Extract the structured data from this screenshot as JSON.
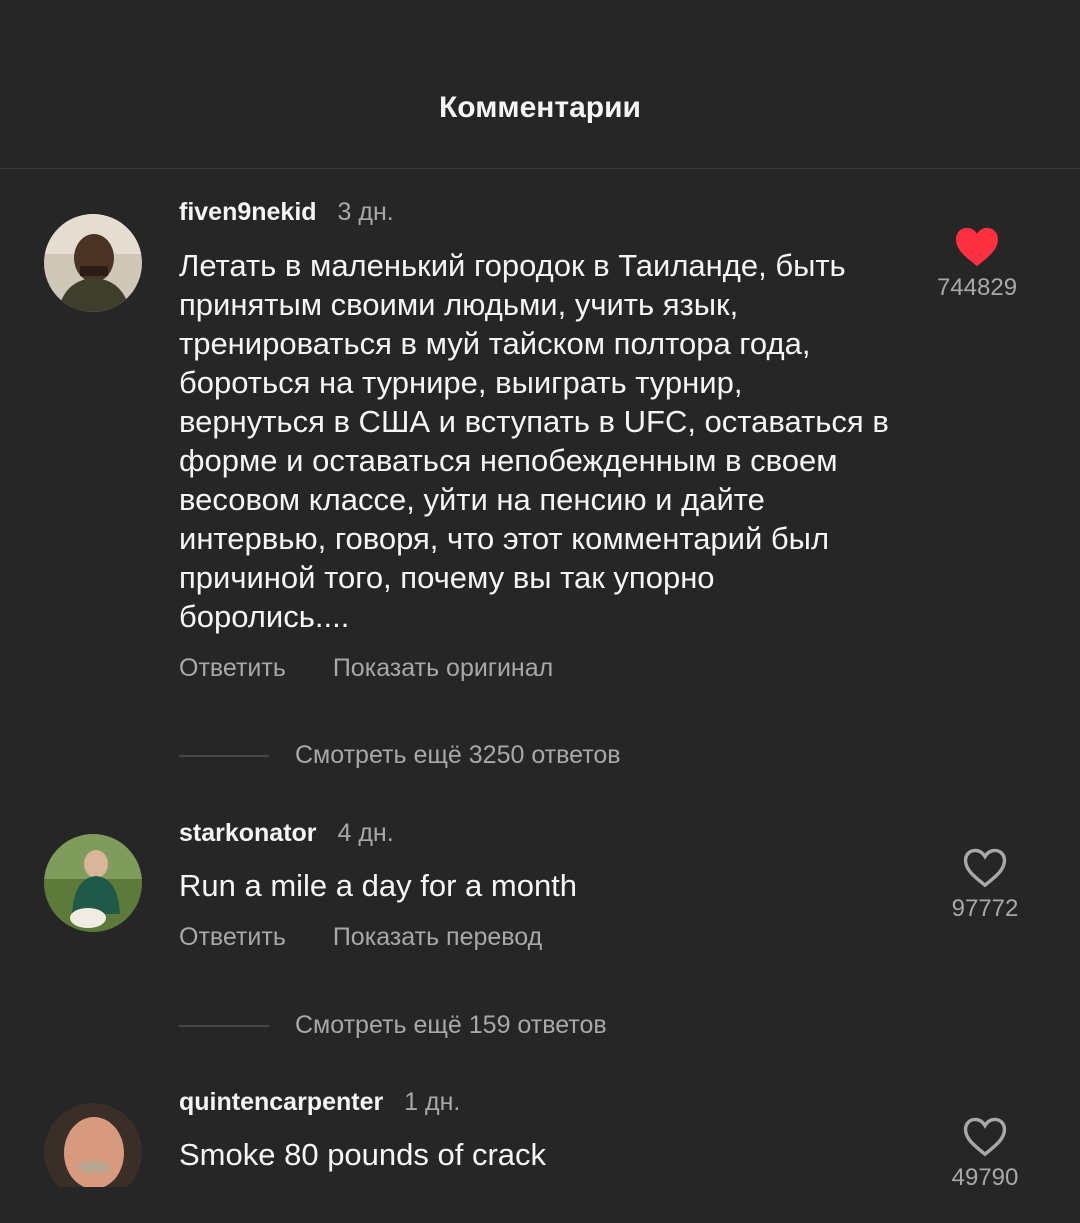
{
  "header": {
    "title": "Комментарии"
  },
  "comments": [
    {
      "username": "fiven9nekid",
      "time": "3 дн.",
      "text": "Летать в маленький городок в Таиланде, быть принятым своими людьми, учить язык, тренироваться в муй тайском полтора года, бороться на турнире, выиграть турнир, вернуться в США и вступать в UFC, оставаться в форме и оставаться непобежденным в своем весовом классе, уйти на пенсию и дайте интервью, говоря, что этот комментарий был причиной того, почему вы так упорно боролись....",
      "reply_label": "Ответить",
      "secondary_action": "Показать оригинал",
      "likes": "744829",
      "liked": true,
      "view_replies": "Смотреть ещё 3250 ответов"
    },
    {
      "username": "starkonator",
      "time": "4 дн.",
      "text": "Run a mile a day for a month",
      "reply_label": "Ответить",
      "secondary_action": "Показать перевод",
      "likes": "97772",
      "liked": false,
      "view_replies": "Смотреть ещё 159 ответов"
    },
    {
      "username": "quintencarpenter",
      "time": "1 дн.",
      "text": "Smoke 80 pounds of crack",
      "likes": "49790",
      "liked": false
    }
  ],
  "colors": {
    "background": "#262626",
    "like_red": "#ff3040",
    "muted": "#a8a8a8"
  },
  "icons": {
    "liked": "heart-filled-icon",
    "not_liked": "heart-outline-icon"
  }
}
